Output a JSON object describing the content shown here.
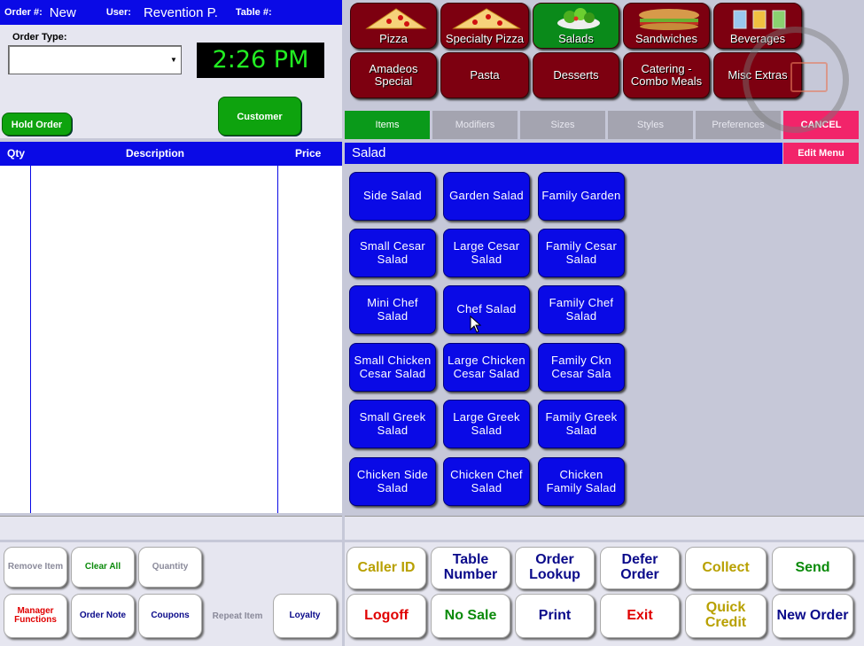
{
  "header": {
    "order_label": "Order #:",
    "order_value": "New",
    "user_label": "User:",
    "user_value": "Revention P.",
    "table_label": "Table #:"
  },
  "order_type": {
    "label": "Order Type:",
    "value": ""
  },
  "clock": "2:26 PM",
  "buttons": {
    "hold_order": "Hold Order",
    "customer": "Customer"
  },
  "order_list": {
    "columns": [
      "Qty",
      "Description",
      "Price"
    ]
  },
  "categories": [
    {
      "label": "Pizza",
      "icon": "pizza-icon"
    },
    {
      "label": "Specialty Pizza",
      "icon": "pizza-icon"
    },
    {
      "label": "Salads",
      "icon": "salad-icon",
      "selected": true
    },
    {
      "label": "Sandwiches",
      "icon": "sandwich-icon"
    },
    {
      "label": "Beverages",
      "icon": "beverage-icon"
    },
    {
      "label": "Amadeos Special"
    },
    {
      "label": "Pasta"
    },
    {
      "label": "Desserts"
    },
    {
      "label": "Catering - Combo Meals"
    },
    {
      "label": "Misc Extras"
    }
  ],
  "tabs": [
    "Items",
    "Modifiers",
    "Sizes",
    "Styles",
    "Preferences"
  ],
  "cancel": "CANCEL",
  "menu_title": "Salad",
  "edit_menu": "Edit Menu",
  "menu_items": [
    [
      "Side Salad",
      "Garden Salad",
      "Family Garden"
    ],
    [
      "Small Cesar Salad",
      "Large Cesar Salad",
      "Family Cesar Salad"
    ],
    [
      "Mini Chef Salad",
      "Chef Salad",
      "Family Chef Salad"
    ],
    [
      "Small Chicken Cesar Salad",
      "Large Chicken Cesar Salad",
      "Family Ckn Cesar Sala"
    ],
    [
      "Small Greek Salad",
      "Large Greek Salad",
      "Family Greek Salad"
    ],
    [
      "Chicken Side Salad",
      "Chicken Chef Salad",
      "Chicken Family Salad"
    ]
  ],
  "left_actions": {
    "remove_item": "Remove Item",
    "clear_all": "Clear All",
    "quantity": "Quantity",
    "manager_functions": "Manager Functions",
    "order_note": "Order Note",
    "coupons": "Coupons",
    "repeat_item": "Repeat Item",
    "loyalty": "Loyalty"
  },
  "right_actions": {
    "caller_id": "Caller ID",
    "table_number": "Table Number",
    "order_lookup": "Order Lookup",
    "defer_order": "Defer Order",
    "collect": "Collect",
    "send": "Send",
    "logoff": "Logoff",
    "no_sale": "No Sale",
    "print": "Print",
    "exit": "Exit",
    "quick_credit": "Quick Credit",
    "new_order": "New Order"
  },
  "colors": {
    "accent_blue": "#0a0ae6",
    "category_red": "#7d0010",
    "selected_green": "#0a8a1a",
    "cancel_pink": "#f2246a"
  }
}
